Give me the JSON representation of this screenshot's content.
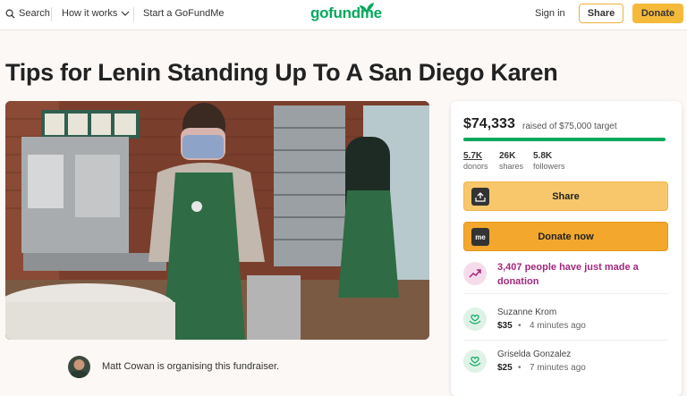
{
  "header": {
    "search_label": "Search",
    "how_it_works_label": "How it works",
    "start_label": "Start a GoFundMe",
    "logo_text": "gofundme",
    "signin_label": "Sign in",
    "share_label": "Share",
    "donate_label": "Donate"
  },
  "campaign": {
    "title": "Tips for Lenin Standing Up To A San Diego Karen",
    "organiser_text": "Matt Cowan is organising this fundraiser."
  },
  "panel": {
    "amount_raised": "$74,333",
    "target_text": "raised of $75,000 target",
    "progress_fraction": 0.991,
    "stats": [
      {
        "value": "5.7K",
        "label": "donors"
      },
      {
        "value": "26K",
        "label": "shares"
      },
      {
        "value": "5.8K",
        "label": "followers"
      }
    ],
    "share_button_label": "Share",
    "donate_button_label": "Donate now",
    "donate_icon_text": "me",
    "trend_text": "3,407 people have just made a donation",
    "donors": [
      {
        "name": "Suzanne Krom",
        "amount": "$35",
        "time": "4 minutes ago"
      },
      {
        "name": "Griselda Gonzalez",
        "amount": "$25",
        "time": "7 minutes ago"
      }
    ]
  },
  "colors": {
    "brand_green": "#02a95c",
    "donate_orange": "#f3a72c",
    "share_yellow": "#f8c76b",
    "trend_magenta": "#a3287e"
  },
  "icons": [
    "search-icon",
    "chevron-down-icon",
    "upload-icon",
    "trend-up-icon",
    "hands-heart-icon"
  ]
}
